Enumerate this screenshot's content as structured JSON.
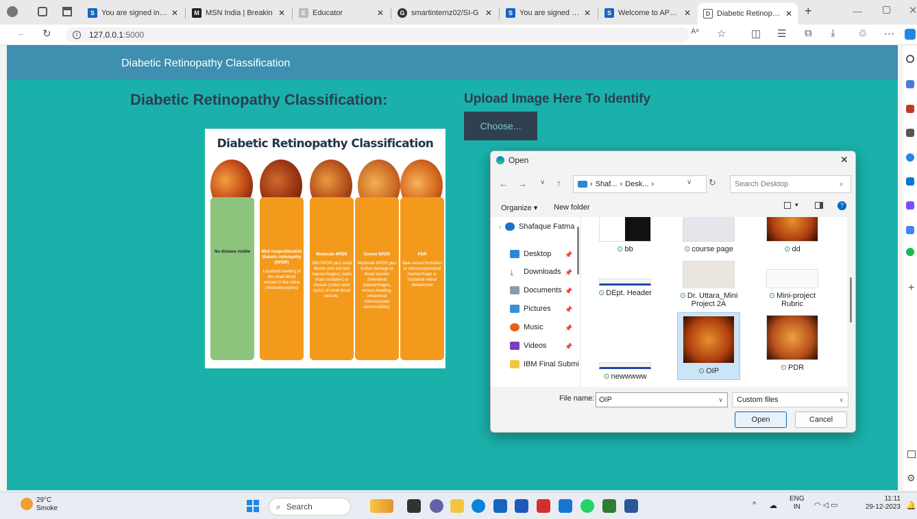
{
  "browser": {
    "tabs": [
      {
        "title": "You are signed in as",
        "favicon": "S"
      },
      {
        "title": "MSN India | Breakin",
        "favicon": "M"
      },
      {
        "title": "Educator",
        "favicon": "E"
      },
      {
        "title": "smartinternz02/SI-G",
        "favicon": "G"
      },
      {
        "title": "You are signed in as",
        "favicon": "S"
      },
      {
        "title": "Welcome to APSIT",
        "favicon": "S"
      },
      {
        "title": "Diabetic Retinopath",
        "favicon": "D"
      }
    ],
    "url_host": "127.0.0.1",
    "url_port": ":5000"
  },
  "page": {
    "nav_title": "Diabetic Retinopathy Classification",
    "left_heading": "Diabetic Retinopathy Classification:",
    "right_heading": "Upload Image Here To Identify",
    "choose_label": "Choose..."
  },
  "infographic": {
    "title": "Diabetic Retinopathy Classification",
    "columns": [
      {
        "name": "No disease visible",
        "desc": "",
        "color": "#8cc47d"
      },
      {
        "name": "Mild nonproliferative diabetic retinopathy (NPDR)",
        "desc": "Localized swelling of the small blood vessels in the retina (microaneurysms)",
        "color": "#f39a1d"
      },
      {
        "name": "Moderate NPDR",
        "desc": "Mild NPDR plus small bleeds (dot and blot haemorrhages), leaks (hard exudates) or closure (cotton wool spots) of small blood vessels.",
        "color": "#f39a1d"
      },
      {
        "name": "Severe NPDR",
        "desc": "Moderate NPDR plus further damage to blood vessels (interetinal haemorrhages, venous beading, intraretinal microvascular abnormalities).",
        "color": "#f39a1d"
      },
      {
        "name": "PDR",
        "desc": "New vessel formation or vitreous/preretinal haemorrhage or tractional retinal detachment",
        "color": "#f39a1d"
      }
    ]
  },
  "dialog": {
    "title": "Open",
    "path": [
      "Shaf...",
      "Desk..."
    ],
    "search_placeholder": "Search Desktop",
    "organize": "Organize ▾",
    "new_folder": "New folder",
    "sidebar": [
      {
        "label": "Shafaque Fatma",
        "pinned": false
      },
      {
        "label": "Desktop",
        "pinned": true
      },
      {
        "label": "Downloads",
        "pinned": true
      },
      {
        "label": "Documents",
        "pinned": true
      },
      {
        "label": "Pictures",
        "pinned": true
      },
      {
        "label": "Music",
        "pinned": true
      },
      {
        "label": "Videos",
        "pinned": true
      },
      {
        "label": "IBM Final Submi",
        "pinned": false
      }
    ],
    "files": [
      {
        "name": "bb"
      },
      {
        "name": "course page"
      },
      {
        "name": "dd"
      },
      {
        "name": "DEpt. Header"
      },
      {
        "name": "Dr. Uttara_Mini Project 2A"
      },
      {
        "name": "Mini-project Rubric"
      },
      {
        "name": "newwwww"
      },
      {
        "name": "OIP"
      },
      {
        "name": "PDR"
      }
    ],
    "file_name_label": "File name:",
    "file_name_value": "OIP",
    "file_type": "Custom files",
    "open_label": "Open",
    "cancel_label": "Cancel"
  },
  "taskbar": {
    "weather_temp": "29°C",
    "weather_desc": "Smoke",
    "search_label": "Search",
    "lang_top": "ENG",
    "lang_bottom": "IN",
    "time": "11:11",
    "date": "29-12-2023"
  }
}
